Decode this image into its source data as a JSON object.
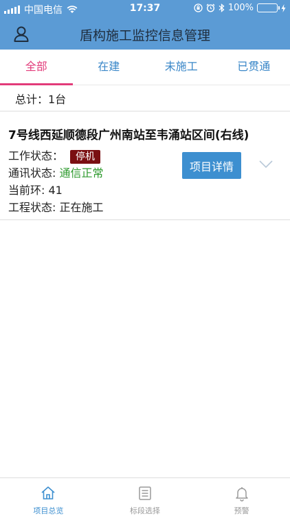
{
  "status_bar": {
    "carrier": "中国电信",
    "time": "17:37",
    "battery": "100%"
  },
  "header": {
    "title": "盾构施工监控信息管理"
  },
  "tabs": [
    {
      "label": "全部",
      "active": true
    },
    {
      "label": "在建",
      "active": false
    },
    {
      "label": "未施工",
      "active": false
    },
    {
      "label": "已贯通",
      "active": false
    }
  ],
  "summary": {
    "total": "总计：1台"
  },
  "project": {
    "title": "7号线西延顺德段广州南站至韦涌站区间(右线)",
    "work_status_label": "工作状态：",
    "work_status_value": "停机",
    "comm_status_label": "通讯状态: ",
    "comm_status_value": "通信正常",
    "current_ring": "当前环: 41",
    "project_status": "工程状态: 正在施工",
    "detail_button": "项目详情"
  },
  "bottom_nav": [
    {
      "label": "项目总览",
      "icon": "home-icon",
      "active": true
    },
    {
      "label": "标段选择",
      "icon": "list-icon",
      "active": false
    },
    {
      "label": "预警",
      "icon": "bell-icon",
      "active": false
    }
  ],
  "colors": {
    "header_bg": "#5b9bd5",
    "tab_active": "#e23b7a",
    "tab_inactive": "#3a87c8",
    "badge_bg": "#7a0f12",
    "ok_green": "#2e9a2e",
    "button_bg": "#3d8fd0"
  }
}
